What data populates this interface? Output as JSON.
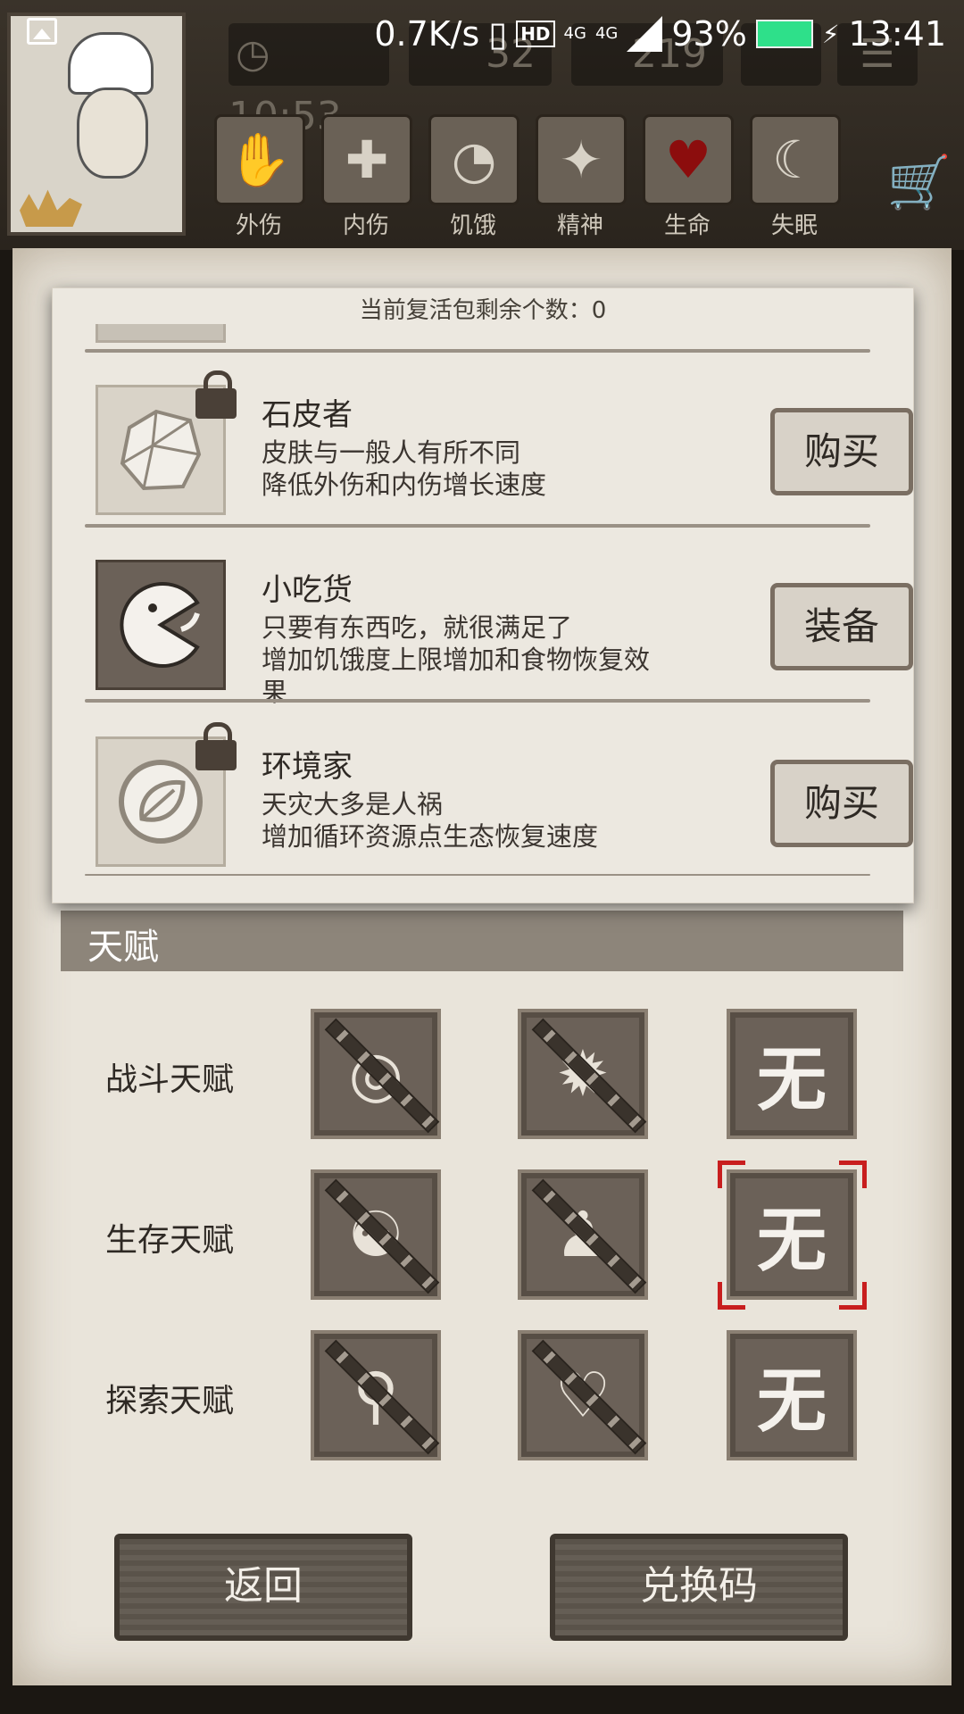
{
  "status_bar": {
    "speed": "0.7K/s",
    "hd": "HD",
    "net1": "4G",
    "net2": "4G",
    "battery": "93%",
    "time": "13:41"
  },
  "hud": {
    "clock": "10:53",
    "value2": "32",
    "value3": "219",
    "stats": [
      {
        "label": "外伤",
        "icon": "hand-icon"
      },
      {
        "label": "内伤",
        "icon": "cross-icon"
      },
      {
        "label": "饥饿",
        "icon": "stomach-icon"
      },
      {
        "label": "精神",
        "icon": "head-icon"
      },
      {
        "label": "生命",
        "icon": "heart-icon"
      },
      {
        "label": "失眠",
        "icon": "moon-icon"
      }
    ]
  },
  "popup": {
    "header": "当前复活包剩余个数：0",
    "perks": [
      {
        "title": "石皮者",
        "desc1": "皮肤与一般人有所不同",
        "desc2": "降低外伤和内伤增长速度",
        "button": "购买",
        "locked": true,
        "icon": "stone-skin-icon"
      },
      {
        "title": "小吃货",
        "desc1": "只要有东西吃，就很满足了",
        "desc2": "增加饥饿度上限增加和食物恢复效果",
        "button": "装备",
        "locked": false,
        "icon": "pacman-icon"
      },
      {
        "title": "环境家",
        "desc1": "天灾大多是人祸",
        "desc2": "增加循环资源点生态恢复速度",
        "button": "购买",
        "locked": true,
        "icon": "recycle-leaf-icon"
      }
    ]
  },
  "talent": {
    "title": "天赋",
    "rows": [
      {
        "label": "战斗天赋"
      },
      {
        "label": "生存天赋"
      },
      {
        "label": "探索天赋"
      }
    ],
    "empty_label": "无"
  },
  "buttons": {
    "back": "返回",
    "redeem": "兑换码"
  }
}
